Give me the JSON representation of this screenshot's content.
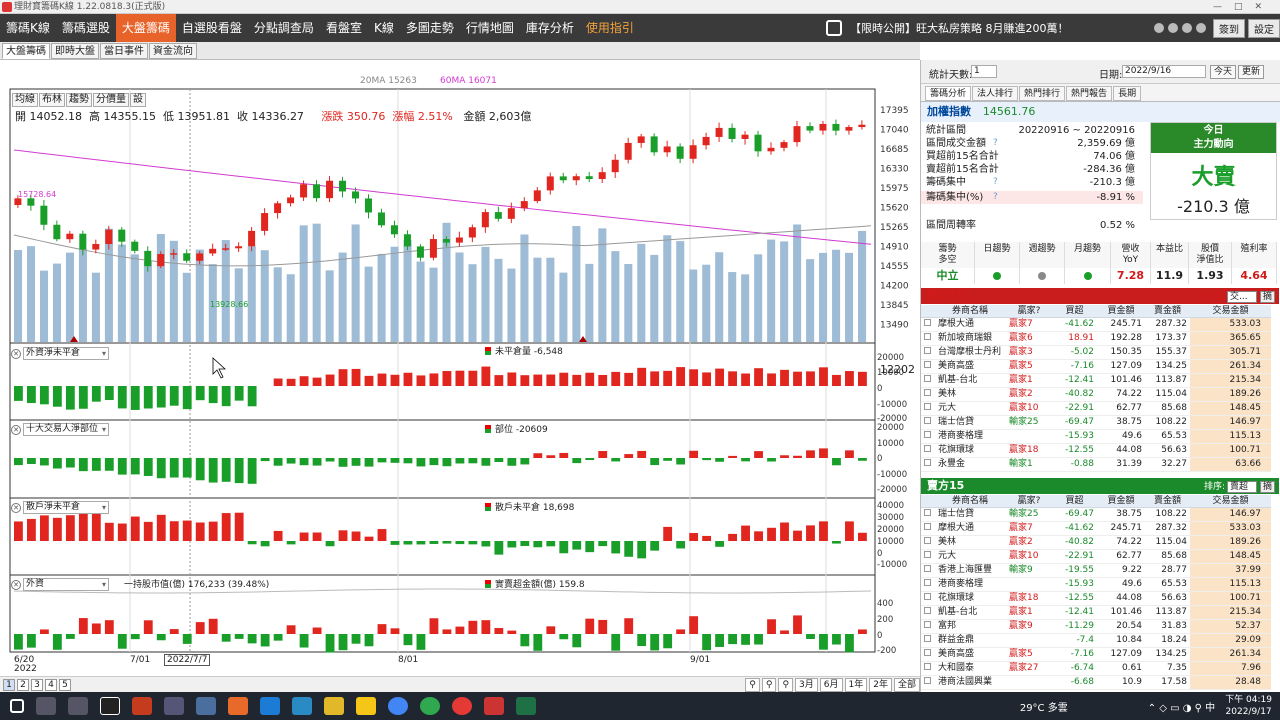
{
  "titlebar": {
    "title": "理財寶籌碼K線 1.22.0818.3(正式版)"
  },
  "nav": [
    "籌碼K線",
    "籌碼選股",
    "大盤籌碼",
    "自選股看盤",
    "分點調查局",
    "看盤室",
    "K線",
    "多圖走勢",
    "行情地圖",
    "庫存分析",
    "使用指引"
  ],
  "nav_active": 2,
  "promo": "【限時公開】旺大私房策略 8月賺進200萬！",
  "top_btns": [
    "簽到",
    "設定"
  ],
  "subtabs": [
    "大盤籌碼",
    "即時大盤",
    "當日事件",
    "資金流向"
  ],
  "ma": {
    "ma20": "20MA 15263",
    "ma60": "60MA 16071"
  },
  "ind_buttons": [
    "均線",
    "布林",
    "趨勢",
    "分價量",
    "設"
  ],
  "ohlc": {
    "open": "開 14052.18",
    "high": "高 14355.15",
    "low": "低 13951.81",
    "close": "收 14336.27",
    "chg": "漲跌 350.76",
    "pct": "漲幅 2.51%",
    "amount": "金額 2,603億"
  },
  "price_labels": {
    "hi": "15728.64",
    "lo": "13928.66"
  },
  "y_axis": [
    "17395",
    "17040",
    "16685",
    "16330",
    "15975",
    "15620",
    "15265",
    "14910",
    "14555",
    "14200",
    "13845",
    "13490"
  ],
  "panels": [
    {
      "sel": "外資淨未平倉",
      "label": "未平倉量 -6,548",
      "ticks": [
        "20000",
        "10000",
        "0",
        "-10000",
        "-20000"
      ]
    },
    {
      "sel": "十大交易人淨部位",
      "label": "部位 -20609",
      "ticks": [
        "20000",
        "10000",
        "0",
        "-10000",
        "-20000"
      ]
    },
    {
      "sel": "散戶淨未平倉",
      "label": "散戶未平倉 18,698",
      "ticks": [
        "40000",
        "30000",
        "20000",
        "10000",
        "0",
        "-10000"
      ]
    },
    {
      "sel": "外資",
      "label": "實賣超金額(億) 159.8",
      "extra": "一持股市值(億) 176,233 (39.48%)",
      "ticks": [
        "400",
        "200",
        "0",
        "-200",
        "-400"
      ]
    }
  ],
  "hover_value": "12202",
  "x_labels": {
    "a": "6/20",
    "a2": "2022",
    "b": "7/01",
    "c": "2022/7/7",
    "d": "8/01",
    "e": "9/01"
  },
  "pager": [
    "1",
    "2",
    "3",
    "4",
    "5"
  ],
  "ranges": [
    "3月",
    "6月",
    "1年",
    "2年",
    "全部"
  ],
  "right": {
    "stat_days_label": "統計天數:",
    "stat_days": "1",
    "date_label": "日期:",
    "date": "2022/9/16",
    "today": "今天",
    "refresh": "更新",
    "tabs": [
      "籌碼分析",
      "法人排行",
      "熱門排行",
      "熱門報告",
      "長期"
    ],
    "index_name": "加權指數",
    "index_val": "14561.76",
    "stats": [
      {
        "k": "統計區間",
        "v": "20220916 ~ 20220916"
      },
      {
        "k": "區間成交金額",
        "v": "2,359.69 億"
      },
      {
        "k": "買超前15名合計",
        "v": "74.06 億"
      },
      {
        "k": "賣超前15名合計",
        "v": "-284.36 億"
      },
      {
        "k": "籌碼集中",
        "v": "-210.3 億"
      },
      {
        "k": "籌碼集中(%)",
        "v": "-8.91 %"
      },
      {
        "k": "區間周轉率",
        "v": "0.52 %"
      }
    ],
    "mainforce": {
      "title1": "今日",
      "title2": "主力動向",
      "big": "大賣",
      "val": "-210.3 億"
    },
    "trend_heads": [
      "籌勢\n多空",
      "日趨勢",
      "週趨勢",
      "月趨勢",
      "營收\nYoY",
      "本益比",
      "股價\n淨值比",
      "殖利率"
    ],
    "trend_vals": [
      "中立",
      "",
      "",
      "",
      "7.28",
      "11.9",
      "1.93",
      "4.64"
    ],
    "buy_title": "買方15",
    "sell_title": "賣方15",
    "sort_label": "排序:",
    "buy_sort": "交...",
    "sell_sort": "賣超",
    "sort_btn": "摘",
    "cols": [
      "券商名稱",
      "贏家?",
      "買超",
      "買金額",
      "賣金額",
      "交易金額"
    ],
    "buy_rows": [
      [
        "摩根大通",
        "贏家7",
        "-41.62",
        "245.71",
        "287.32",
        "533.03"
      ],
      [
        "新加坡商瑞銀",
        "贏家6",
        "18.91",
        "192.28",
        "173.37",
        "365.65"
      ],
      [
        "台灣摩根士丹利",
        "贏家3",
        "-5.02",
        "150.35",
        "155.37",
        "305.71"
      ],
      [
        "美商高盛",
        "贏家5",
        "-7.16",
        "127.09",
        "134.25",
        "261.34"
      ],
      [
        "凱基-台北",
        "贏家1",
        "-12.41",
        "101.46",
        "113.87",
        "215.34"
      ],
      [
        "美林",
        "贏家2",
        "-40.82",
        "74.22",
        "115.04",
        "189.26"
      ],
      [
        "元大",
        "贏家10",
        "-22.91",
        "62.77",
        "85.68",
        "148.45"
      ],
      [
        "瑞士信貸",
        "輸家25",
        "-69.47",
        "38.75",
        "108.22",
        "146.97"
      ],
      [
        "港商麥格理",
        "",
        "-15.93",
        "49.6",
        "65.53",
        "115.13"
      ],
      [
        "花旗環球",
        "贏家18",
        "-12.55",
        "44.08",
        "56.63",
        "100.71"
      ],
      [
        "永豐金",
        "輸家1",
        "-0.88",
        "31.39",
        "32.27",
        "63.66"
      ]
    ],
    "sell_rows": [
      [
        "瑞士信貸",
        "輸家25",
        "-69.47",
        "38.75",
        "108.22",
        "146.97"
      ],
      [
        "摩根大通",
        "贏家7",
        "-41.62",
        "245.71",
        "287.32",
        "533.03"
      ],
      [
        "美林",
        "贏家2",
        "-40.82",
        "74.22",
        "115.04",
        "189.26"
      ],
      [
        "元大",
        "贏家10",
        "-22.91",
        "62.77",
        "85.68",
        "148.45"
      ],
      [
        "香港上海匯豐",
        "輸家9",
        "-19.55",
        "9.22",
        "28.77",
        "37.99"
      ],
      [
        "港商麥格理",
        "",
        "-15.93",
        "49.6",
        "65.53",
        "115.13"
      ],
      [
        "花旗環球",
        "贏家18",
        "-12.55",
        "44.08",
        "56.63",
        "100.71"
      ],
      [
        "凱基-台北",
        "贏家1",
        "-12.41",
        "101.46",
        "113.87",
        "215.34"
      ],
      [
        "富邦",
        "贏家9",
        "-11.29",
        "20.54",
        "31.83",
        "52.37"
      ],
      [
        "群益金鼎",
        "",
        "-7.4",
        "10.84",
        "18.24",
        "29.09"
      ],
      [
        "美商高盛",
        "贏家5",
        "-7.16",
        "127.09",
        "134.25",
        "261.34"
      ],
      [
        "大和國泰",
        "贏家27",
        "-6.74",
        "0.61",
        "7.35",
        "7.96"
      ],
      [
        "港商法國興業",
        "",
        "-6.68",
        "10.9",
        "17.58",
        "28.48"
      ]
    ]
  },
  "taskbar": {
    "weather": "29°C 多雲",
    "time": "下午 04:19",
    "date": "2022/9/17"
  },
  "colors": {
    "up": "#e0261f",
    "down": "#1a9e2a",
    "volume": "#9fbcd6",
    "ma20": "#999999",
    "ma60": "#d23ad2",
    "nav_active": "#e8632a"
  }
}
